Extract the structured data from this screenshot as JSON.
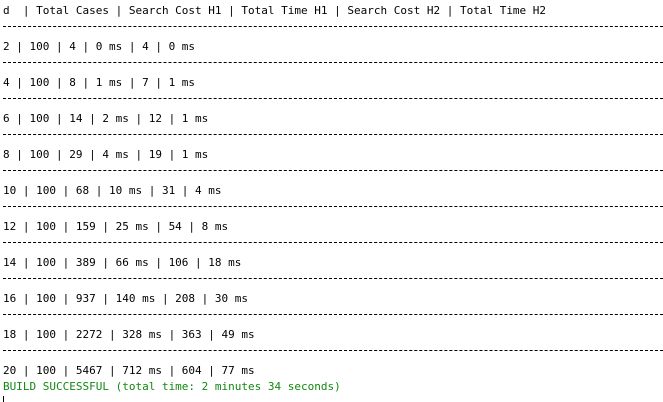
{
  "header": "d  | Total Cases | Search Cost H1 | Total Time H1 | Search Cost H2 | Total Time H2",
  "rows": [
    "2 | 100 | 4 | 0 ms | 4 | 0 ms",
    "4 | 100 | 8 | 1 ms | 7 | 1 ms",
    "6 | 100 | 14 | 2 ms | 12 | 1 ms",
    "8 | 100 | 29 | 4 ms | 19 | 1 ms",
    "10 | 100 | 68 | 10 ms | 31 | 4 ms",
    "12 | 100 | 159 | 25 ms | 54 | 8 ms",
    "14 | 100 | 389 | 66 ms | 106 | 18 ms",
    "16 | 100 | 937 | 140 ms | 208 | 30 ms",
    "18 | 100 | 2272 | 328 ms | 363 | 49 ms",
    "20 | 100 | 5467 | 712 ms | 604 | 77 ms"
  ],
  "build_status": "BUILD SUCCESSFUL (total time: 2 minutes 34 seconds)",
  "colors": {
    "text": "#000000",
    "build_success": "#118811",
    "background": "#ffffff"
  }
}
